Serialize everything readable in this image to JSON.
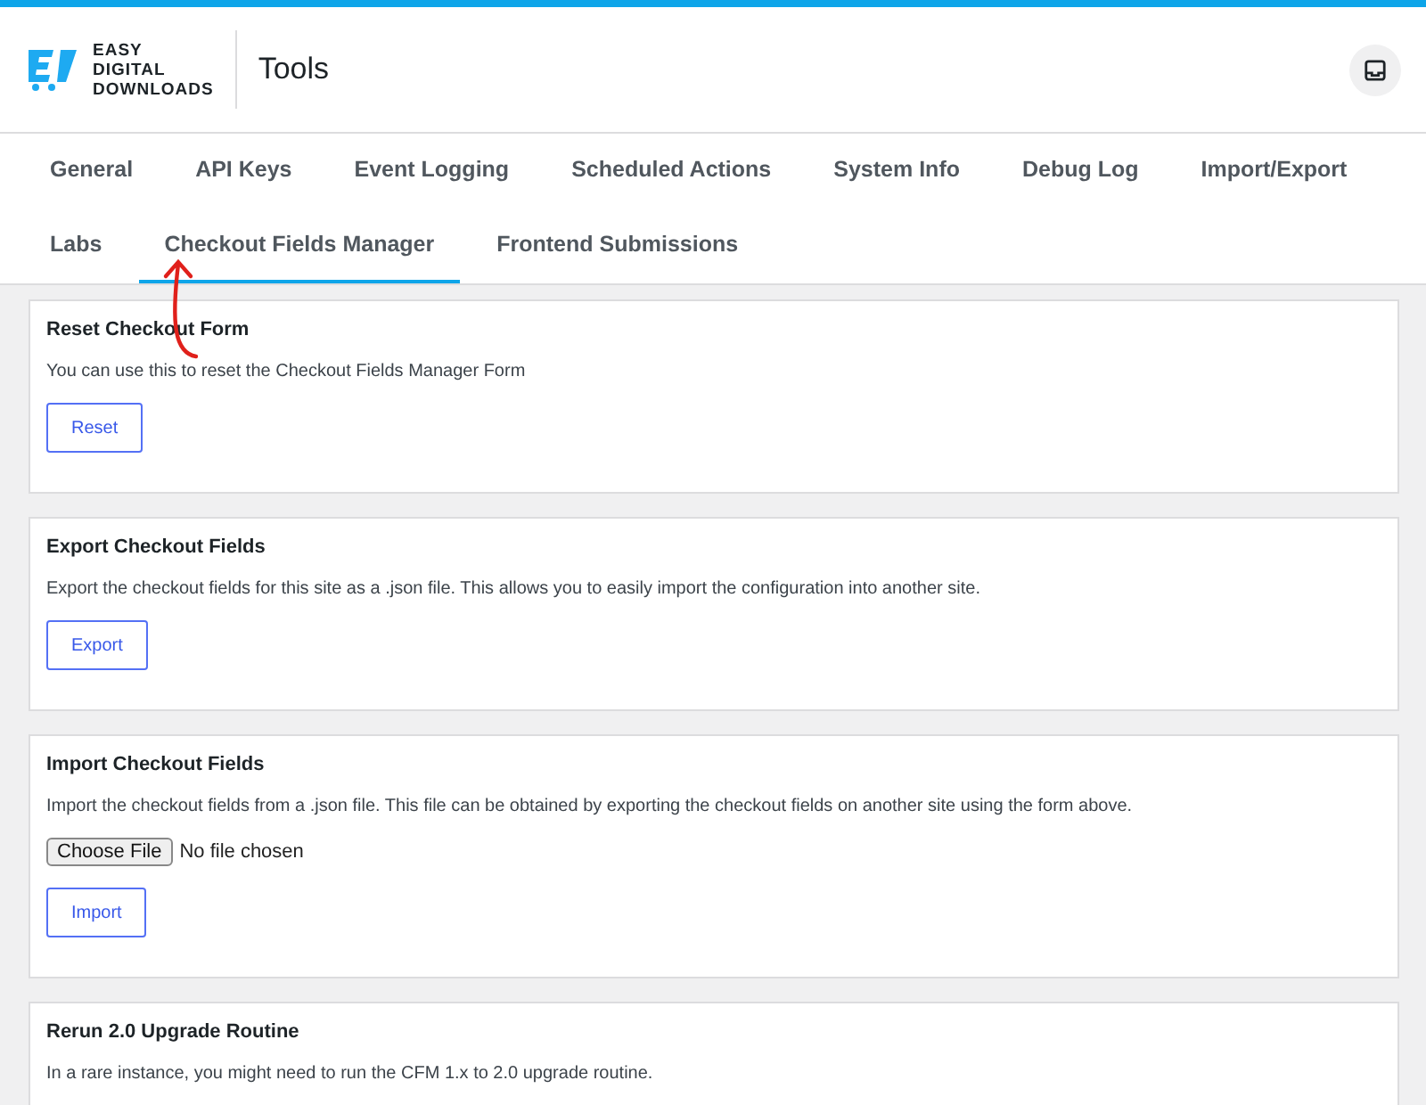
{
  "header": {
    "logo_text": [
      "EASY",
      "DIGITAL",
      "DOWNLOADS"
    ],
    "title": "Tools"
  },
  "tabs": [
    {
      "label": "General",
      "selected": false
    },
    {
      "label": "API Keys",
      "selected": false
    },
    {
      "label": "Event Logging",
      "selected": false
    },
    {
      "label": "Scheduled Actions",
      "selected": false
    },
    {
      "label": "System Info",
      "selected": false
    },
    {
      "label": "Debug Log",
      "selected": false
    },
    {
      "label": "Import/Export",
      "selected": false
    },
    {
      "label": "Labs",
      "selected": false
    },
    {
      "label": "Checkout Fields Manager",
      "selected": true
    },
    {
      "label": "Frontend Submissions",
      "selected": false
    }
  ],
  "cards": [
    {
      "kind": "button",
      "title": "Reset Checkout Form",
      "text": "You can use this to reset the Checkout Fields Manager Form",
      "button": "Reset"
    },
    {
      "kind": "button",
      "title": "Export Checkout Fields",
      "text": "Export the checkout fields for this site as a .json file. This allows you to easily import the configuration into another site.",
      "button": "Export"
    },
    {
      "kind": "file",
      "title": "Import Checkout Fields",
      "text": "Import the checkout fields from a .json file. This file can be obtained by exporting the checkout fields on another site using the form above.",
      "file_button": "Choose File",
      "file_status": "No file chosen",
      "button": "Import"
    },
    {
      "kind": "text",
      "title": "Rerun 2.0 Upgrade Routine",
      "text": "In a rare instance, you might need to run the CFM 1.x to 2.0 upgrade routine."
    }
  ]
}
